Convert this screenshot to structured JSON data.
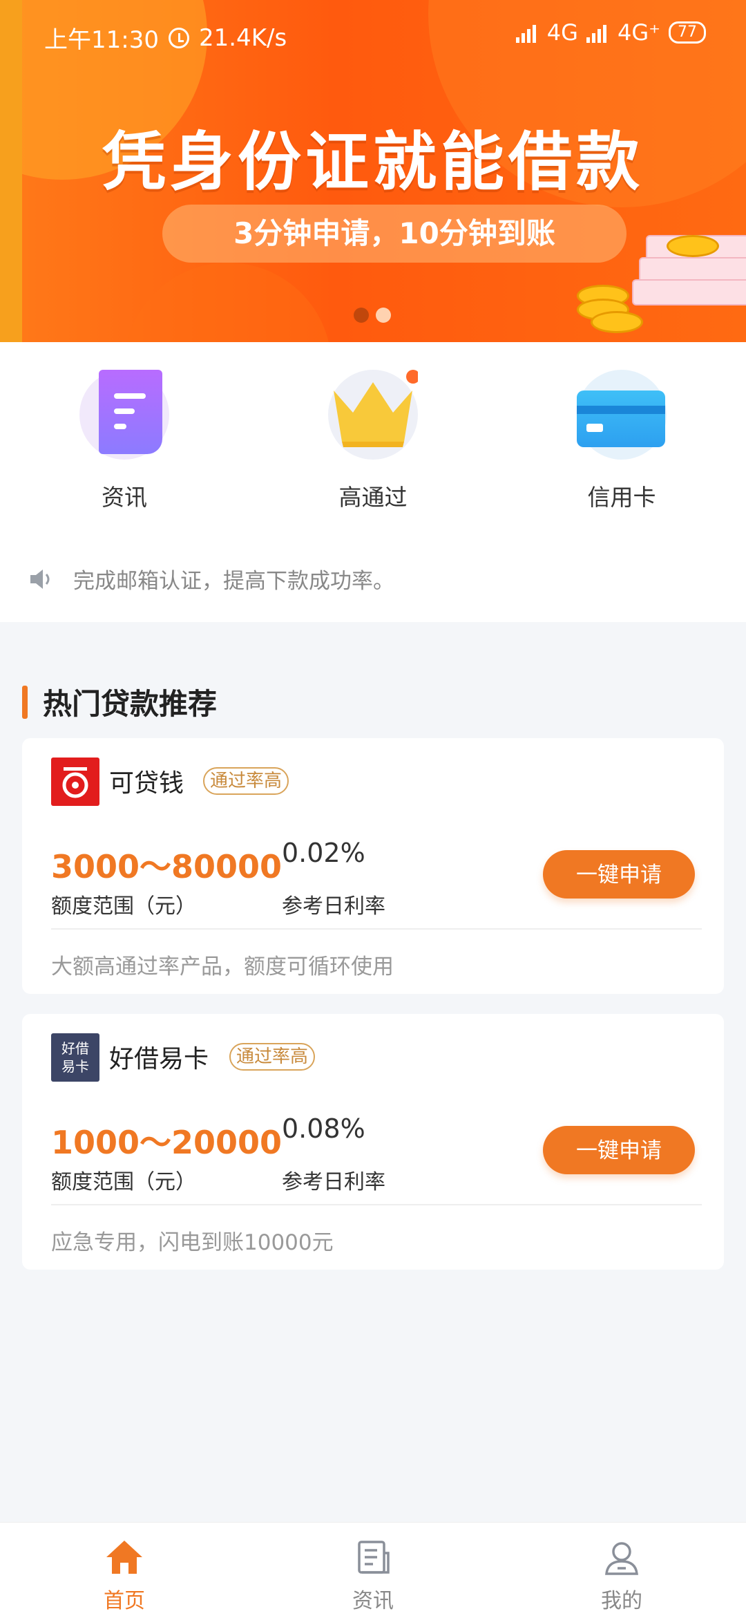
{
  "status_bar": {
    "time": "上午11:30",
    "speed": "21.4K/s",
    "net1": "4G",
    "net2": "4G⁺",
    "battery": "77"
  },
  "banner": {
    "headline": "凭身份证就能借款",
    "subline": "3分钟申请，10分钟到账",
    "colors": {
      "main": "#ff5a0e",
      "active_dot": "#c0470c",
      "inactive_dot": "#ffd2b0"
    }
  },
  "quick_nav": [
    {
      "label": "资讯",
      "icon": "document-icon"
    },
    {
      "label": "高通过",
      "icon": "crown-icon"
    },
    {
      "label": "信用卡",
      "icon": "credit-card-icon"
    }
  ],
  "notice": {
    "text": "完成邮箱认证，提高下款成功率。",
    "icon": "speaker-icon"
  },
  "section": {
    "title": "热门贷款推荐",
    "accent": "#f07823"
  },
  "loans": [
    {
      "name": "可贷钱",
      "tag": "通过率高",
      "range": "3000～80000",
      "range_label": "额度范围（元）",
      "rate": "0.02%",
      "rate_label": "参考日利率",
      "button": "一键申请",
      "desc": "大额高通过率产品，额度可循环使用",
      "logo_color": "#e21d1d"
    },
    {
      "name": "好借易卡",
      "tag": "通过率高",
      "range": "1000～20000",
      "range_label": "额度范围（元）",
      "rate": "0.08%",
      "rate_label": "参考日利率",
      "button": "一键申请",
      "desc": "应急专用，闪电到账10000元",
      "logo_text_1": "好借",
      "logo_text_2": "易卡",
      "logo_color": "#3c4566"
    }
  ],
  "tabbar": [
    {
      "label": "首页",
      "icon": "home-icon",
      "active": true
    },
    {
      "label": "资讯",
      "icon": "news-icon",
      "active": false
    },
    {
      "label": "我的",
      "icon": "user-icon",
      "active": false
    }
  ]
}
